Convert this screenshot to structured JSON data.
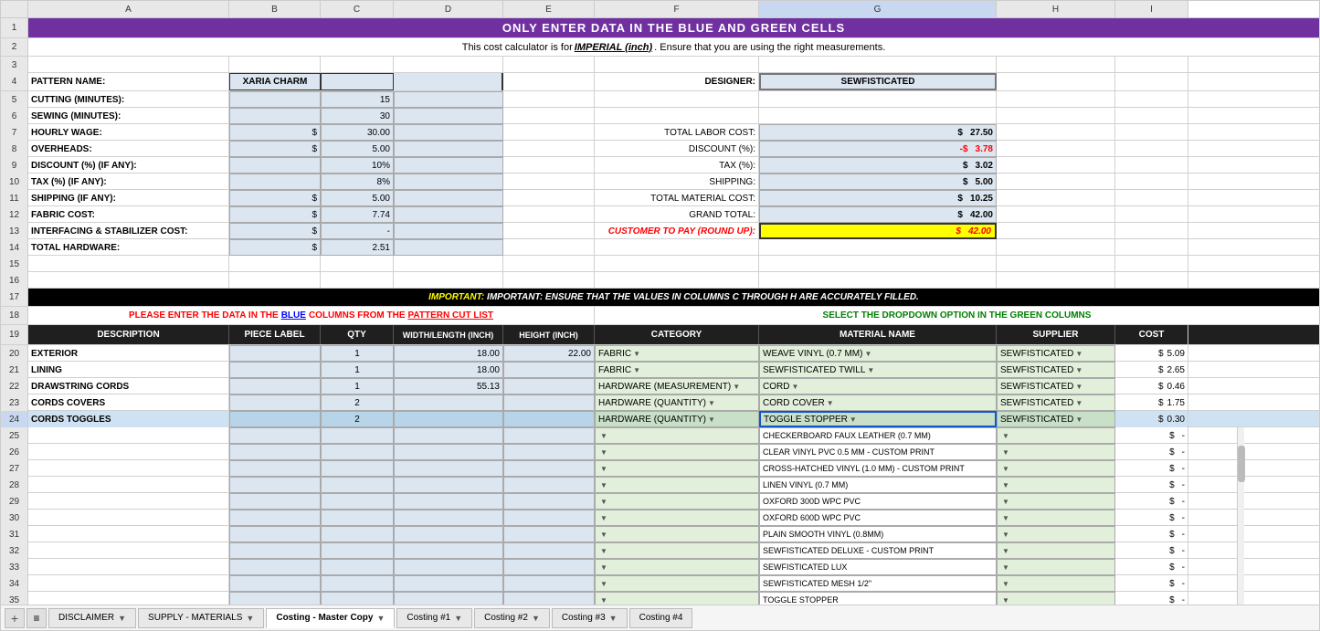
{
  "header": {
    "title": "ONLY ENTER DATA IN THE BLUE AND GREEN CELLS",
    "subtitle_prefix": "This cost calculator is for ",
    "subtitle_bold_underline": "IMPERIAL (inch)",
    "subtitle_suffix": ".  Ensure that you are using the right measurements."
  },
  "pattern_name_label": "PATTERN NAME:",
  "pattern_name_value": "XARIA CHARM",
  "designer_label": "DESIGNER:",
  "designer_value": "SEWFISTICATED",
  "cutting_label": "CUTTING (MINUTES):",
  "cutting_value": "15",
  "sewing_label": "SEWING (MINUTES):",
  "sewing_value": "30",
  "hourly_wage_label": "HOURLY WAGE:",
  "hourly_wage_value": "30.00",
  "overheads_label": "OVERHEADS:",
  "overheads_value": "5.00",
  "discount_label": "DISCOUNT (%) (IF ANY):",
  "discount_value": "10%",
  "tax_label": "TAX (%) (IF ANY):",
  "tax_value": "8%",
  "shipping_label": "SHIPPING (IF ANY):",
  "shipping_value": "5.00",
  "fabric_cost_label": "FABRIC COST:",
  "fabric_cost_value": "7.74",
  "interfacing_label": "INTERFACING & STABILIZER COST:",
  "interfacing_value": "-",
  "total_hardware_label": "TOTAL HARDWARE:",
  "total_hardware_value": "2.51",
  "total_labor_label": "TOTAL LABOR COST:",
  "total_labor_value": "27.50",
  "discount_calc_label": "DISCOUNT (%):",
  "discount_calc_value": "3.78",
  "tax_calc_label": "TAX (%):",
  "tax_calc_value": "3.02",
  "shipping_calc_label": "SHIPPING:",
  "shipping_calc_value": "5.00",
  "total_material_label": "TOTAL MATERIAL COST:",
  "total_material_value": "10.25",
  "grand_total_label": "GRAND TOTAL:",
  "grand_total_value": "42.00",
  "customer_pay_label": "CUSTOMER TO PAY (ROUND UP):",
  "customer_pay_value": "42.00",
  "important_notice": "IMPORTANT: ENSURE THAT THE VALUES IN COLUMNS C THROUGH H ARE ACCURATELY FILLED.",
  "blue_section_label": "PLEASE ENTER THE DATA IN THE BLUE COLUMNS FROM THE PATTERN CUT LIST",
  "green_section_label": "SELECT THE DROPDOWN OPTION IN THE GREEN COLUMNS",
  "table_headers": {
    "description": "DESCRIPTION",
    "piece_label": "PIECE LABEL",
    "qty": "QTY",
    "width_length": "WIDTH/LENGTH (INCH)",
    "height": "HEIGHT (INCH)",
    "category": "CATEGORY",
    "material_name": "MATERIAL NAME",
    "supplier": "SUPPLIER",
    "cost": "COST"
  },
  "table_rows": [
    {
      "description": "EXTERIOR",
      "piece_label": "",
      "qty": "1",
      "width": "18.00",
      "height": "22.00",
      "category": "FABRIC",
      "material": "WEAVE VINYL (0.7 MM)",
      "supplier": "SEWFISTICATED",
      "cost": "5.09"
    },
    {
      "description": "LINING",
      "piece_label": "",
      "qty": "1",
      "width": "18.00",
      "height": "",
      "category": "FABRIC",
      "material": "SEWFISTICATED TWILL",
      "supplier": "SEWFISTICATED",
      "cost": "2.65"
    },
    {
      "description": "DRAWSTRING CORDS",
      "piece_label": "",
      "qty": "1",
      "width": "55.13",
      "height": "",
      "category": "HARDWARE (MEASUREMENT)",
      "material": "CORD",
      "supplier": "SEWFISTICATED",
      "cost": "0.46"
    },
    {
      "description": "CORDS COVERS",
      "piece_label": "",
      "qty": "2",
      "width": "",
      "height": "",
      "category": "HARDWARE (QUANTITY)",
      "material": "CORD COVER",
      "supplier": "SEWFISTICATED",
      "cost": "1.75"
    },
    {
      "description": "CORDS TOGGLES",
      "piece_label": "",
      "qty": "2",
      "width": "",
      "height": "",
      "category": "HARDWARE (QUANTITY)",
      "material": "TOGGLE STOPPER",
      "supplier": "SEWFISTICATED",
      "cost": "0.30"
    }
  ],
  "dropdown_items": [
    "CHECKERBOARD FAUX LEATHER (0.7 MM)",
    "CLEAR VINYL PVC 0.5 MM - CUSTOM PRINT",
    "CROSS-HATCHED VINYL (1.0 MM) - CUSTOM PRINT",
    "LINEN VINYL (0.7 MM)",
    "OXFORD 300D WPC PVC",
    "OXFORD 600D WPC PVC",
    "PLAIN SMOOTH VINYL (0.8MM)",
    "SEWFISTICATED DELUXE - CUSTOM PRINT",
    "SEWFISTICATED LUX",
    "SEWFISTICATED MESH 1/2\"",
    "TOGGLE STOPPER"
  ],
  "tabs": [
    {
      "label": "DISCLAIMER",
      "active": false
    },
    {
      "label": "SUPPLY - MATERIALS",
      "active": false
    },
    {
      "label": "Costing - Master Copy",
      "active": false
    },
    {
      "label": "Costing #1",
      "active": false
    },
    {
      "label": "Costing #2",
      "active": false
    },
    {
      "label": "Costing #3",
      "active": false
    },
    {
      "label": "Costing #4",
      "active": false
    }
  ],
  "col_headers": [
    "A",
    "B",
    "C",
    "D",
    "E",
    "F",
    "G",
    "H",
    "I"
  ],
  "row_numbers": [
    "1",
    "2",
    "3",
    "4",
    "5",
    "6",
    "7",
    "8",
    "9",
    "10",
    "11",
    "12",
    "13",
    "14",
    "15",
    "16",
    "17",
    "18",
    "19",
    "20",
    "21",
    "22",
    "23",
    "24",
    "25",
    "26",
    "27",
    "28",
    "29",
    "30",
    "31",
    "32",
    "33",
    "34",
    "35"
  ]
}
